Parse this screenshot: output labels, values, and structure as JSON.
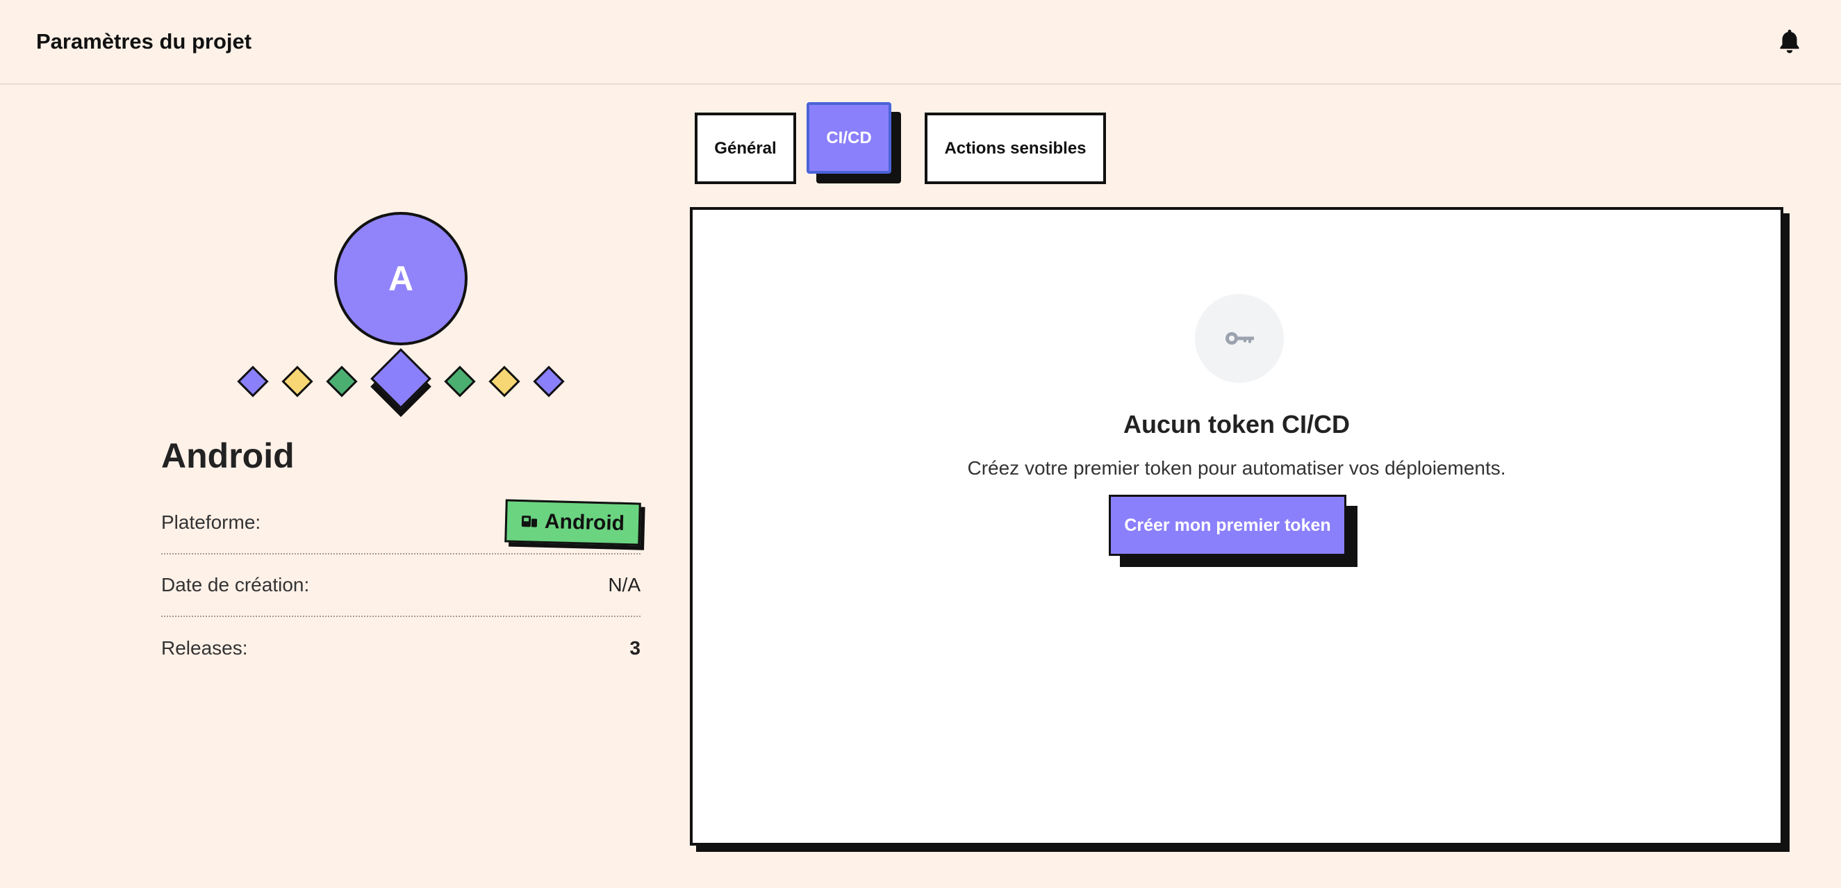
{
  "header": {
    "title": "Paramètres du projet",
    "notifications_icon": "bell-icon"
  },
  "profile": {
    "avatar_initial": "A",
    "name": "Android",
    "platform_label": "Plateforme:",
    "platform_value": "Android",
    "platform_icon": "android-icon",
    "created_label": "Date de création:",
    "created_value": "N/A",
    "releases_label": "Releases:",
    "releases_value": "3",
    "diamond_colors": [
      "#8b80fb",
      "#f7d774",
      "#4caf72",
      "#8b80fb",
      "#4caf72",
      "#f7d774",
      "#8b80fb"
    ]
  },
  "tabs": [
    {
      "label": "Général",
      "active": false
    },
    {
      "label": "CI/CD",
      "active": true
    },
    {
      "label": "Actions sensibles",
      "active": false
    }
  ],
  "cicd": {
    "empty_icon": "key-icon",
    "empty_title": "Aucun token CI/CD",
    "empty_description": "Créez votre premier token pour automatiser vos déploiements.",
    "create_button_label": "Créer mon premier token"
  },
  "colors": {
    "background": "#fef1e8",
    "accent": "#8b80fb",
    "platform_badge": "#6bd480",
    "yellow": "#f7d774",
    "green": "#4caf72"
  }
}
